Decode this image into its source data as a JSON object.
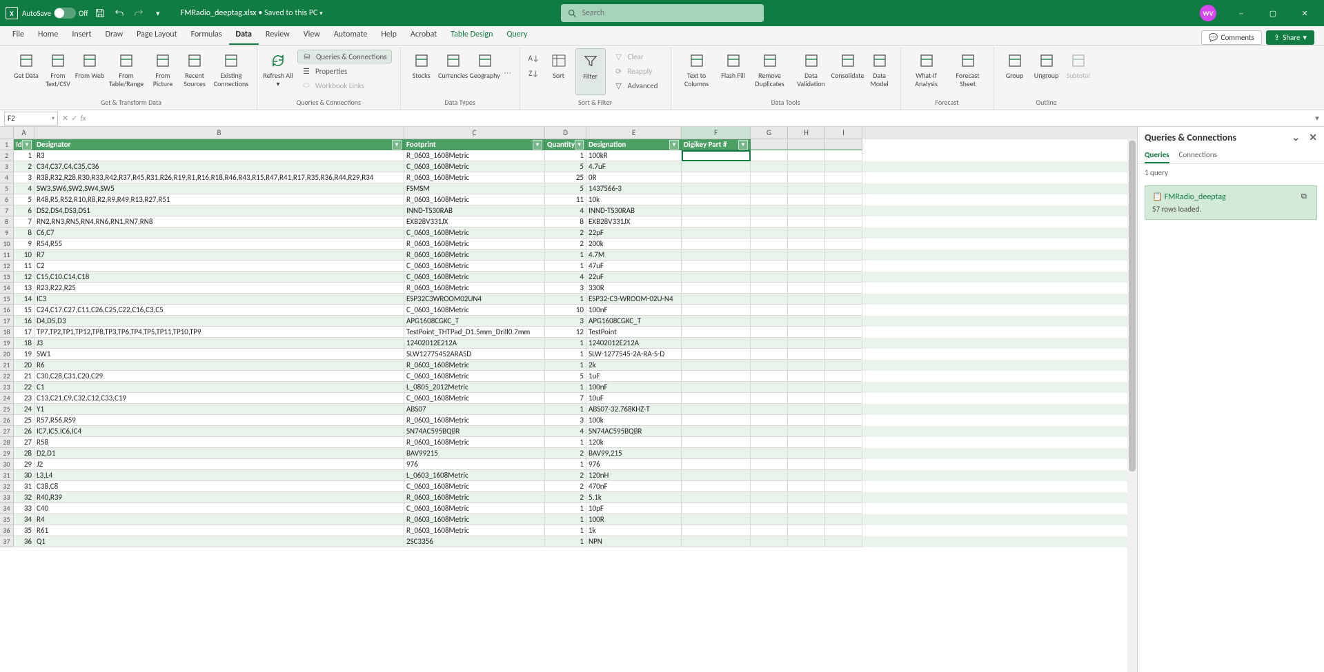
{
  "title": {
    "autosave": "AutoSave",
    "autosave_state": "Off",
    "filename": "FMRadio_deeptag.xlsx",
    "saved": "Saved to this PC",
    "search_ph": "Search",
    "avatar": "WV"
  },
  "tabs": [
    "File",
    "Home",
    "Insert",
    "Draw",
    "Page Layout",
    "Formulas",
    "Data",
    "Review",
    "View",
    "Automate",
    "Help",
    "Acrobat",
    "Table Design",
    "Query"
  ],
  "tabs_active": "Data",
  "tabs_colored": [
    "Table Design",
    "Query"
  ],
  "comments_btn": "Comments",
  "share_btn": "Share",
  "ribbon": {
    "get_transform": {
      "items": [
        "Get Data",
        "From Text/CSV",
        "From Web",
        "From Table/Range",
        "From Picture",
        "Recent Sources",
        "Existing Connections"
      ],
      "label": "Get & Transform Data"
    },
    "queries": {
      "refresh": "Refresh All",
      "qc": "Queries & Connections",
      "props": "Properties",
      "links": "Workbook Links",
      "label": "Queries & Connections"
    },
    "datatypes": {
      "items": [
        "Stocks",
        "Currencies",
        "Geography"
      ],
      "label": "Data Types"
    },
    "sortfilter": {
      "sort_az": "",
      "sort_za": "",
      "sort": "Sort",
      "filter": "Filter",
      "clear": "Clear",
      "reapply": "Reapply",
      "advanced": "Advanced",
      "label": "Sort & Filter"
    },
    "datatools": {
      "items": [
        "Text to Columns",
        "Flash Fill",
        "Remove Duplicates",
        "Data Validation",
        "Consolidate",
        "Data Model"
      ],
      "label": "Data Tools"
    },
    "forecast": {
      "items": [
        "What-If Analysis",
        "Forecast Sheet"
      ],
      "label": "Forecast"
    },
    "outline": {
      "items": [
        "Group",
        "Ungroup",
        "Subtotal"
      ],
      "label": "Outline"
    }
  },
  "namebox": "F2",
  "columns": {
    "A": 30,
    "B": 536,
    "C": 204,
    "D": 60,
    "E": 138,
    "F": 100,
    "G": 54,
    "H": 54,
    "I": 54
  },
  "col_order": [
    "A",
    "B",
    "C",
    "D",
    "E",
    "F",
    "G",
    "H",
    "I"
  ],
  "active_col": "F",
  "headers": {
    "A": "Id",
    "B": "Designator",
    "C": "Footprint",
    "D": "Quantity",
    "E": "Designation",
    "F": "Digikey Part #"
  },
  "rows": [
    {
      "n": 1,
      "hdr": true
    },
    {
      "n": 2,
      "A": "1",
      "B": "R3",
      "C": "R_0603_1608Metric",
      "D": "1",
      "E": "100kR",
      "F": "",
      "sel": true
    },
    {
      "n": 3,
      "A": "2",
      "B": "C34,C37,C4,C35,C36",
      "C": "C_0603_1608Metric",
      "D": "5",
      "E": "4.7uF",
      "band": true
    },
    {
      "n": 4,
      "A": "3",
      "B": "R38,R32,R28,R30,R33,R42,R37,R45,R31,R26,R19,R1,R16,R18,R46,R43,R15,R47,R41,R17,R35,R36,R44,R29,R34",
      "C": "R_0603_1608Metric",
      "D": "25",
      "E": "0R"
    },
    {
      "n": 5,
      "A": "4",
      "B": "SW3,SW6,SW2,SW4,SW5",
      "C": "FSMSM",
      "D": "5",
      "E": "1437566-3",
      "band": true
    },
    {
      "n": 6,
      "A": "5",
      "B": "R48,R5,R52,R10,R8,R2,R9,R49,R13,R27,R51",
      "C": "R_0603_1608Metric",
      "D": "11",
      "E": "10k"
    },
    {
      "n": 7,
      "A": "6",
      "B": "DS2,DS4,DS3,DS1",
      "C": "INND-TS30RAB",
      "D": "4",
      "E": "INND-TS30RAB",
      "band": true
    },
    {
      "n": 8,
      "A": "7",
      "B": "RN2,RN3,RN5,RN4,RN6,RN1,RN7,RN8",
      "C": "EXB28V331JX",
      "D": "8",
      "E": "EXB28V331JX"
    },
    {
      "n": 9,
      "A": "8",
      "B": "C6,C7",
      "C": "C_0603_1608Metric",
      "D": "2",
      "E": "22pF",
      "band": true
    },
    {
      "n": 10,
      "A": "9",
      "B": "R54,R55",
      "C": "R_0603_1608Metric",
      "D": "2",
      "E": "200k"
    },
    {
      "n": 11,
      "A": "10",
      "B": "R7",
      "C": "R_0603_1608Metric",
      "D": "1",
      "E": "4.7M",
      "band": true
    },
    {
      "n": 12,
      "A": "11",
      "B": "C2",
      "C": "C_0603_1608Metric",
      "D": "1",
      "E": "47uF"
    },
    {
      "n": 13,
      "A": "12",
      "B": "C15,C10,C14,C18",
      "C": "C_0603_1608Metric",
      "D": "4",
      "E": "22uF",
      "band": true
    },
    {
      "n": 14,
      "A": "13",
      "B": "R23,R22,R25",
      "C": "R_0603_1608Metric",
      "D": "3",
      "E": "330R"
    },
    {
      "n": 15,
      "A": "14",
      "B": "IC3",
      "C": "ESP32C3WROOM02UN4",
      "D": "1",
      "E": "ESP32-C3-WROOM-02U-N4",
      "band": true
    },
    {
      "n": 16,
      "A": "15",
      "B": "C24,C17,C27,C11,C26,C25,C22,C16,C3,C5",
      "C": "C_0603_1608Metric",
      "D": "10",
      "E": "100nF"
    },
    {
      "n": 17,
      "A": "16",
      "B": "D4,D5,D3",
      "C": "APG1608CGKC_T",
      "D": "3",
      "E": "APG1608CGKC_T",
      "band": true
    },
    {
      "n": 18,
      "A": "17",
      "B": "TP7,TP2,TP1,TP12,TP8,TP3,TP6,TP4,TP5,TP11,TP10,TP9",
      "C": "TestPoint_THTPad_D1.5mm_Drill0.7mm",
      "D": "12",
      "E": "TestPoint"
    },
    {
      "n": 19,
      "A": "18",
      "B": "J3",
      "C": "12402012E212A",
      "D": "1",
      "E": "12402012E212A",
      "band": true
    },
    {
      "n": 20,
      "A": "19",
      "B": "SW1",
      "C": "SLW12775452ARASD",
      "D": "1",
      "E": "SLW-1277545-2A-RA-S-D"
    },
    {
      "n": 21,
      "A": "20",
      "B": "R6",
      "C": "R_0603_1608Metric",
      "D": "1",
      "E": "2k",
      "band": true
    },
    {
      "n": 22,
      "A": "21",
      "B": "C30,C28,C31,C20,C29",
      "C": "C_0603_1608Metric",
      "D": "5",
      "E": "1uF"
    },
    {
      "n": 23,
      "A": "22",
      "B": "C1",
      "C": "L_0805_2012Metric",
      "D": "1",
      "E": "100nF",
      "band": true
    },
    {
      "n": 24,
      "A": "23",
      "B": "C13,C21,C9,C32,C12,C33,C19",
      "C": "C_0603_1608Metric",
      "D": "7",
      "E": "10uF"
    },
    {
      "n": 25,
      "A": "24",
      "B": "Y1",
      "C": "ABS07",
      "D": "1",
      "E": "ABS07-32.768KHZ-T",
      "band": true
    },
    {
      "n": 26,
      "A": "25",
      "B": "R57,R56,R59",
      "C": "R_0603_1608Metric",
      "D": "3",
      "E": "100k"
    },
    {
      "n": 27,
      "A": "26",
      "B": "IC7,IC5,IC6,IC4",
      "C": "SN74AC595BQBR",
      "D": "4",
      "E": "SN74AC595BQBR",
      "band": true
    },
    {
      "n": 28,
      "A": "27",
      "B": "R58",
      "C": "R_0603_1608Metric",
      "D": "1",
      "E": "120k"
    },
    {
      "n": 29,
      "A": "28",
      "B": "D2,D1",
      "C": "BAV99215",
      "D": "2",
      "E": "BAV99,215",
      "band": true
    },
    {
      "n": 30,
      "A": "29",
      "B": "J2",
      "C": "976",
      "D": "1",
      "E": "976"
    },
    {
      "n": 31,
      "A": "30",
      "B": "L3,L4",
      "C": "L_0603_1608Metric",
      "D": "2",
      "E": "120nH",
      "band": true
    },
    {
      "n": 32,
      "A": "31",
      "B": "C38,C8",
      "C": "C_0603_1608Metric",
      "D": "2",
      "E": "470nF"
    },
    {
      "n": 33,
      "A": "32",
      "B": "R40,R39",
      "C": "R_0603_1608Metric",
      "D": "2",
      "E": "5.1k",
      "band": true
    },
    {
      "n": 34,
      "A": "33",
      "B": "C40",
      "C": "C_0603_1608Metric",
      "D": "1",
      "E": "10pF"
    },
    {
      "n": 35,
      "A": "34",
      "B": "R4",
      "C": "R_0603_1608Metric",
      "D": "1",
      "E": "100R",
      "band": true
    },
    {
      "n": 36,
      "A": "35",
      "B": "R61",
      "C": "R_0603_1608Metric",
      "D": "1",
      "E": "1k"
    },
    {
      "n": 37,
      "A": "36",
      "B": "Q1",
      "C": "2SC3356",
      "D": "1",
      "E": "NPN",
      "band": true
    }
  ],
  "panel": {
    "title": "Queries & Connections",
    "tabs": [
      "Queries",
      "Connections"
    ],
    "tab_active": "Queries",
    "count": "1 query",
    "query_name": "FMRadio_deeptag",
    "query_rows": "57 rows loaded."
  }
}
